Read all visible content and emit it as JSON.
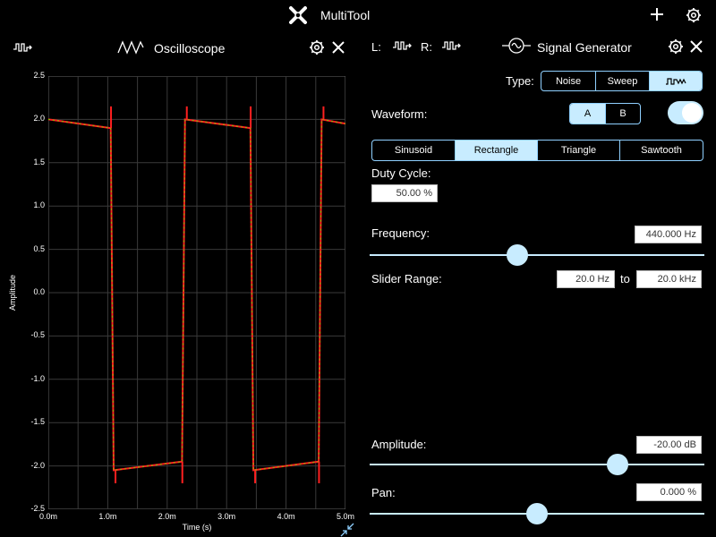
{
  "app": {
    "title": "MultiTool",
    "accent": "#c8ecff"
  },
  "oscilloscope": {
    "title": "Oscilloscope",
    "y_ticks": [
      "2.5",
      "2.0",
      "1.5",
      "1.0",
      "0.5",
      "0.0",
      "-0.5",
      "-1.0",
      "-1.5",
      "-2.0",
      "-2.5"
    ],
    "x_ticks": [
      "0.0m",
      "1.0m",
      "2.0m",
      "3.0m",
      "4.0m",
      "5.0m"
    ],
    "ylabel": "Amplitude",
    "xlabel": "Time (s)"
  },
  "channels": {
    "left_label": "L:",
    "right_label": "R:"
  },
  "generator": {
    "title": "Signal Generator",
    "type_label": "Type:",
    "types": [
      "Noise",
      "Sweep"
    ],
    "selected_type": 2,
    "waveform_label": "Waveform:",
    "ab_options": [
      "A",
      "B"
    ],
    "selected_ab": 0,
    "toggle_on": true,
    "shapes": [
      "Sinusoid",
      "Rectangle",
      "Triangle",
      "Sawtooth"
    ],
    "selected_shape": 1,
    "duty_cycle_label": "Duty Cycle:",
    "duty_cycle_value": "50.00 %",
    "frequency_label": "Frequency:",
    "frequency_value": "440.000 Hz",
    "frequency_slider": 0.44,
    "slider_range_label": "Slider Range:",
    "range_from": "20.0 Hz",
    "range_to_label": "to",
    "range_to": "20.0 kHz",
    "amplitude_label": "Amplitude:",
    "amplitude_value": "-20.00 dB",
    "amplitude_slider": 0.74,
    "pan_label": "Pan:",
    "pan_value": "0.000 %",
    "pan_slider": 0.5
  },
  "chart_data": {
    "type": "line",
    "title": "",
    "xlabel": "Time (s)",
    "ylabel": "Amplitude",
    "xlim": [
      0.0,
      5.0
    ],
    "ylim": [
      -2.5,
      2.5
    ],
    "grid": true,
    "series": [
      {
        "color": "#ff2020",
        "x": [
          0.0,
          1.05,
          1.1,
          2.25,
          2.3,
          3.4,
          3.45,
          4.55,
          4.6,
          5.0
        ],
        "y": [
          2.0,
          1.9,
          -2.05,
          -1.95,
          2.0,
          1.9,
          -2.05,
          -1.95,
          2.0,
          1.95
        ]
      },
      {
        "color": "#7cd000",
        "x": [
          0.0,
          1.05,
          1.1,
          2.25,
          2.3,
          3.4,
          3.45,
          4.55,
          4.6,
          5.0
        ],
        "y": [
          2.0,
          1.9,
          -2.05,
          -1.95,
          2.0,
          1.9,
          -2.05,
          -1.95,
          2.0,
          1.95
        ]
      }
    ]
  }
}
